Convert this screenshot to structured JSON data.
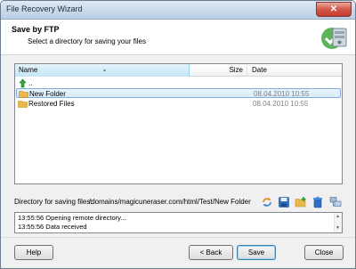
{
  "window": {
    "title": "File Recovery Wizard",
    "close_glyph": "✕"
  },
  "header": {
    "title": "Save by FTP",
    "subtitle": "Select a directory for saving your files"
  },
  "list": {
    "columns": {
      "name": "Name",
      "size": "Size",
      "date": "Date"
    },
    "sort_glyph": "▲",
    "rows": [
      {
        "name": "..",
        "icon": "up-arrow-icon",
        "date": ""
      },
      {
        "name": "New Folder",
        "icon": "folder-icon",
        "date": "08.04.2010 10:55",
        "selected": true
      },
      {
        "name": "Restored Files",
        "icon": "folder-icon",
        "date": "08.04.2010 10:55"
      }
    ]
  },
  "directory": {
    "label": "Directory for saving files:",
    "value": "/domains/magicuneraser.com/html/Test/New Folder"
  },
  "toolbar_icons": [
    "refresh-icon",
    "save-disk-icon",
    "new-folder-icon",
    "delete-icon",
    "network-icon"
  ],
  "log": {
    "lines": [
      "13:55:56 Opening remote directory...",
      "13:55:56 Data received"
    ],
    "scroll_up": "▲",
    "scroll_down": "▼"
  },
  "buttons": {
    "help": "Help",
    "back": "< Back",
    "save": "Save",
    "close": "Close"
  },
  "colors": {
    "selection": "#d7ecfa",
    "accent": "#3c7fb1",
    "folder": "#e8b84a"
  }
}
